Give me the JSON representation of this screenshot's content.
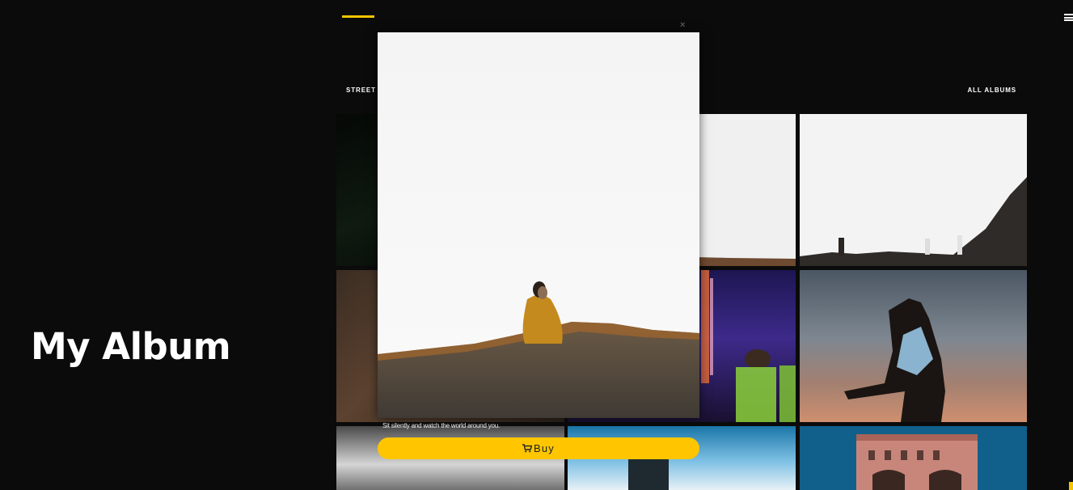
{
  "page": {
    "title": "My Album"
  },
  "nav": {
    "left_label": "STREET",
    "right_label": "ALL ALBUMS"
  },
  "icons": {
    "menu": "hamburger-menu-icon",
    "close": "close-icon",
    "cart": "cart-icon"
  },
  "modal": {
    "close_label": "×",
    "caption": "Sit silently and watch the world around you.",
    "buy_label": "Buy"
  },
  "colors": {
    "background": "#0b0b0b",
    "accent": "#f5c400",
    "buy_button": "#ffc600"
  }
}
